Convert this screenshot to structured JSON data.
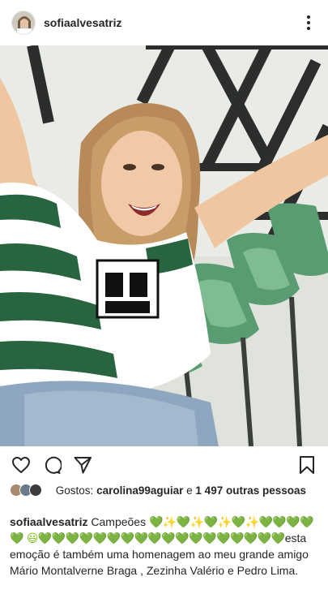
{
  "post": {
    "username": "sofiaalvesatriz",
    "likes": {
      "prefix": "Gostos:",
      "liker": "carolina99aguiar",
      "conjunction": "e",
      "others": "1 497 outras pessoas"
    },
    "caption": {
      "username": "sofiaalvesatriz",
      "word1": "Campeões",
      "emoji_run1": "💚✨💚✨💚✨💚✨💚💚💚💚💚",
      "emoji_run2": "😃💚💚💚💚💚💚💚💚💚💚💚💚💚💚💚💚💚💚",
      "rest_first": "esta",
      "rest": "emoção é também uma homenagem ao meu grande amigo Mário Montalverne Braga , Zezinha Valério e Pedro Lima."
    }
  },
  "icons": {
    "more": "more-vertical-icon",
    "like": "heart-icon",
    "comment": "comment-icon",
    "share": "send-icon",
    "save": "bookmark-icon"
  },
  "colors": {
    "text": "#262626",
    "heart_emoji": "#78c81e",
    "background": "#ffffff"
  }
}
